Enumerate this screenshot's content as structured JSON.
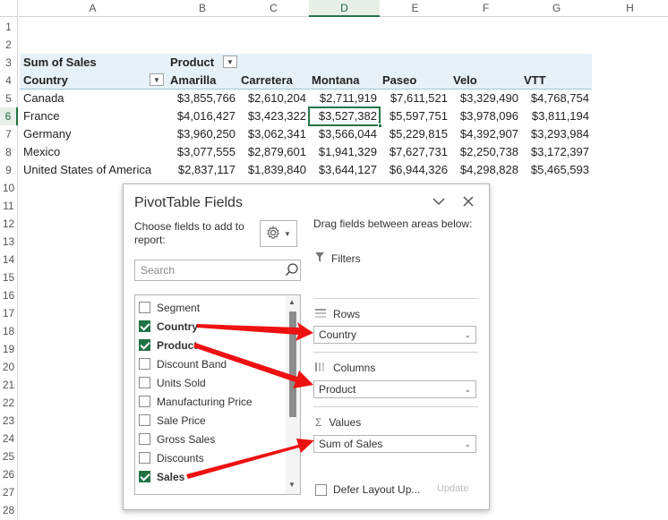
{
  "sheet": {
    "columns": [
      "A",
      "B",
      "C",
      "D",
      "E",
      "F",
      "G",
      "H"
    ],
    "selected_column": "D",
    "rows": [
      "1",
      "2",
      "3",
      "4",
      "5",
      "6",
      "7",
      "8",
      "9",
      "10",
      "11",
      "12",
      "13",
      "14",
      "15",
      "16",
      "17",
      "18",
      "19",
      "20",
      "21",
      "22",
      "23",
      "24",
      "25",
      "26",
      "27",
      "28"
    ],
    "selected_row": "6",
    "pivot": {
      "sum_label": "Sum of Sales",
      "product_label": "Product",
      "country_label": "Country",
      "products": [
        "Amarilla",
        "Carretera",
        "Montana",
        "Paseo",
        "Velo",
        "VTT"
      ],
      "data": [
        {
          "country": "Canada",
          "values": [
            "$3,855,766",
            "$2,610,204",
            "$2,711,919",
            "$7,611,521",
            "$3,329,490",
            "$4,768,754"
          ]
        },
        {
          "country": "France",
          "values": [
            "$4,016,427",
            "$3,423,322",
            "$3,527,382",
            "$5,597,751",
            "$3,978,096",
            "$3,811,194"
          ]
        },
        {
          "country": "Germany",
          "values": [
            "$3,960,250",
            "$3,062,341",
            "$3,566,044",
            "$5,229,815",
            "$4,392,907",
            "$3,293,984"
          ]
        },
        {
          "country": "Mexico",
          "values": [
            "$3,077,555",
            "$2,879,601",
            "$1,941,329",
            "$7,627,731",
            "$2,250,738",
            "$3,172,397"
          ]
        },
        {
          "country": "United States of America",
          "values": [
            "$2,837,117",
            "$1,839,840",
            "$3,644,127",
            "$6,944,326",
            "$4,298,828",
            "$5,465,593"
          ]
        }
      ]
    }
  },
  "pane": {
    "title": "PivotTable Fields",
    "collapse_icon": "chevron-down-icon",
    "close_icon": "close-icon",
    "choose_text": "Choose fields to add to report:",
    "gear_icon": "gear-icon",
    "search_placeholder": "Search",
    "fields": [
      {
        "label": "Segment",
        "checked": false
      },
      {
        "label": "Country",
        "checked": true
      },
      {
        "label": "Product",
        "checked": true
      },
      {
        "label": "Discount Band",
        "checked": false
      },
      {
        "label": "Units Sold",
        "checked": false
      },
      {
        "label": "Manufacturing Price",
        "checked": false
      },
      {
        "label": "Sale Price",
        "checked": false
      },
      {
        "label": "Gross Sales",
        "checked": false
      },
      {
        "label": "Discounts",
        "checked": false
      },
      {
        "label": "Sales",
        "checked": true
      }
    ],
    "drag_text": "Drag fields between areas below:",
    "areas": {
      "filters": "Filters",
      "rows": "Rows",
      "columns": "Columns",
      "values": "Values",
      "rows_value": "Country",
      "columns_value": "Product",
      "values_value": "Sum of Sales"
    },
    "defer_label": "Defer Layout Up...",
    "update_label": "Update"
  },
  "colors": {
    "accent": "#217346",
    "pivot_band": "#e6f2f8",
    "annotation_arrow": "#ee1111"
  }
}
